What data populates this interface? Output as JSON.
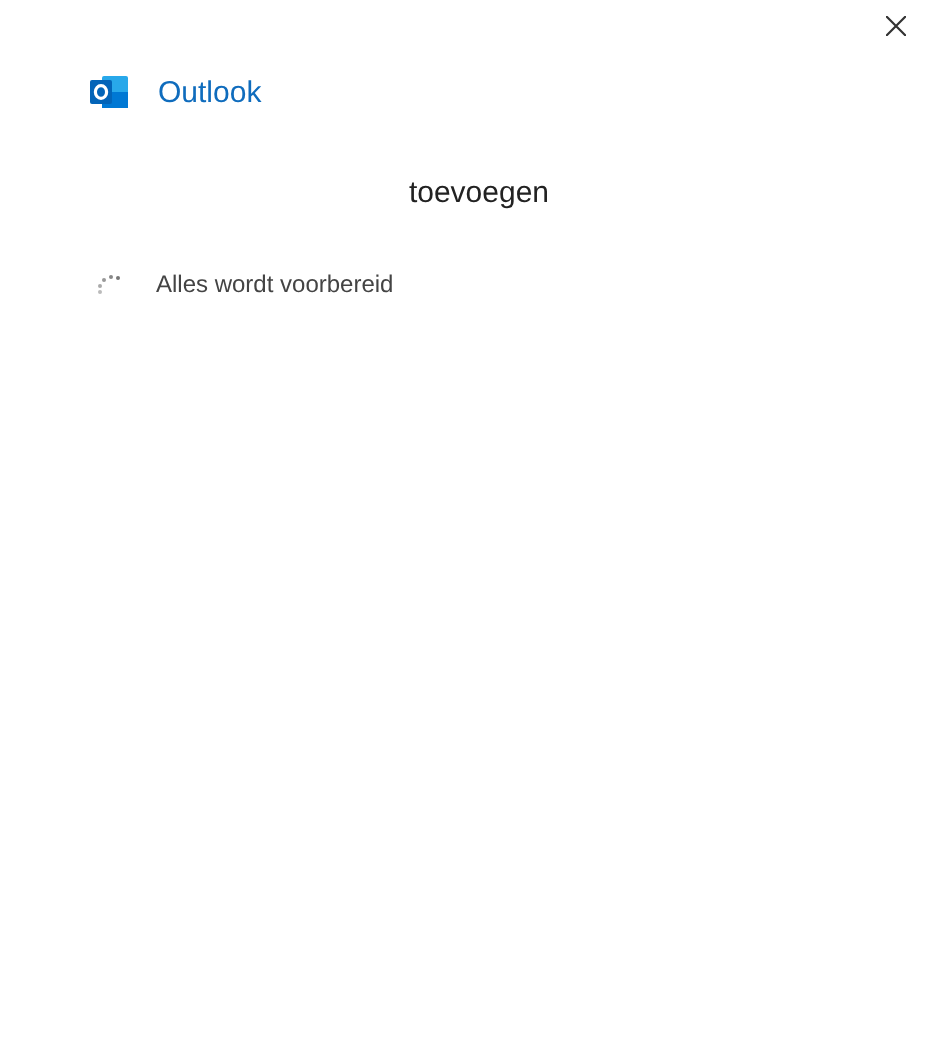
{
  "app": {
    "name": "Outlook"
  },
  "heading": "toevoegen",
  "status": {
    "message": "Alles wordt voorbereid"
  }
}
